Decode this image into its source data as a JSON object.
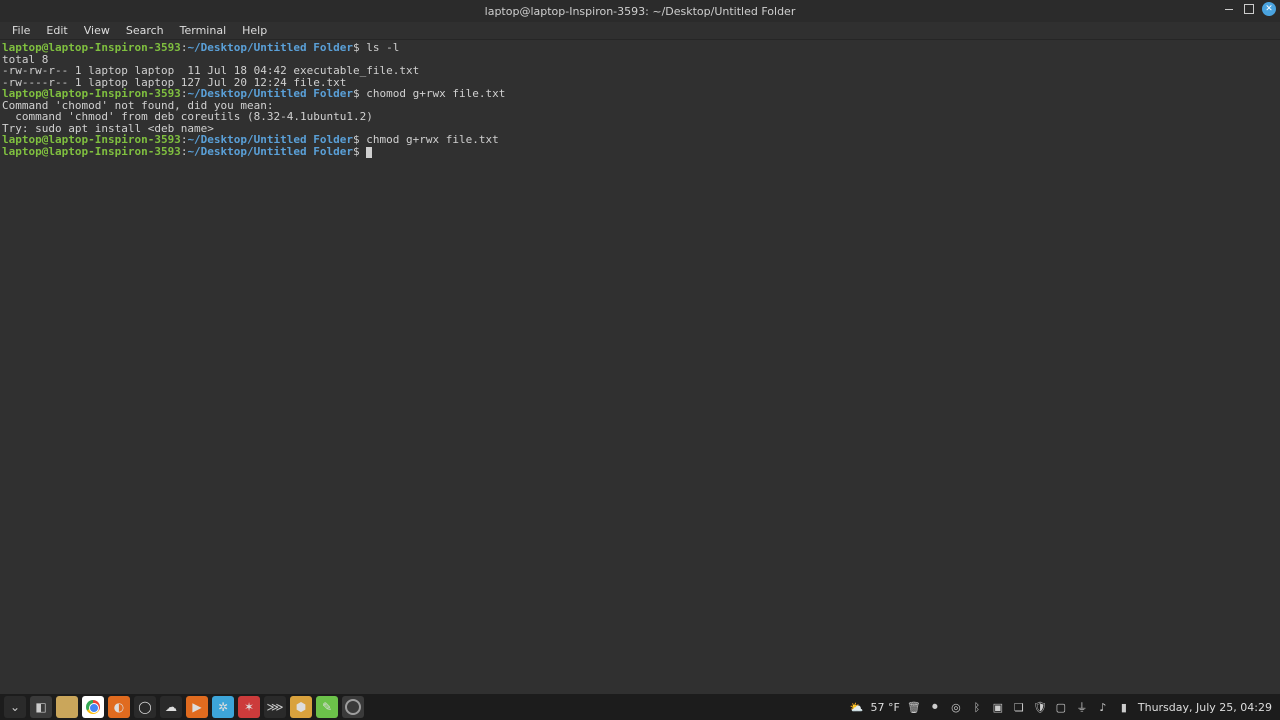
{
  "window": {
    "title": "laptop@laptop-Inspiron-3593: ~/Desktop/Untitled Folder"
  },
  "menu": {
    "file": "File",
    "edit": "Edit",
    "view": "View",
    "search": "Search",
    "terminal": "Terminal",
    "help": "Help"
  },
  "prompt": {
    "userhost": "laptop@laptop-Inspiron-3593",
    "sep": ":",
    "path": "~/Desktop/Untitled Folder",
    "sym": "$ "
  },
  "lines": {
    "cmd1": "ls -l",
    "out1": "total 8",
    "out2": "-rw-rw-r-- 1 laptop laptop  11 Jul 18 04:42 executable_file.txt",
    "out3": "-rw----r-- 1 laptop laptop 127 Jul 20 12:24 file.txt",
    "cmd2": "chomod g+rwx file.txt",
    "out4": "Command 'chomod' not found, did you mean:",
    "out5": "  command 'chmod' from deb coreutils (8.32-4.1ubuntu1.2)",
    "out6": "Try: sudo apt install <deb name>",
    "cmd3": "chmod g+rwx file.txt"
  },
  "tray": {
    "temp": "57 °F",
    "clock": "Thursday, July 25, 04:29"
  }
}
